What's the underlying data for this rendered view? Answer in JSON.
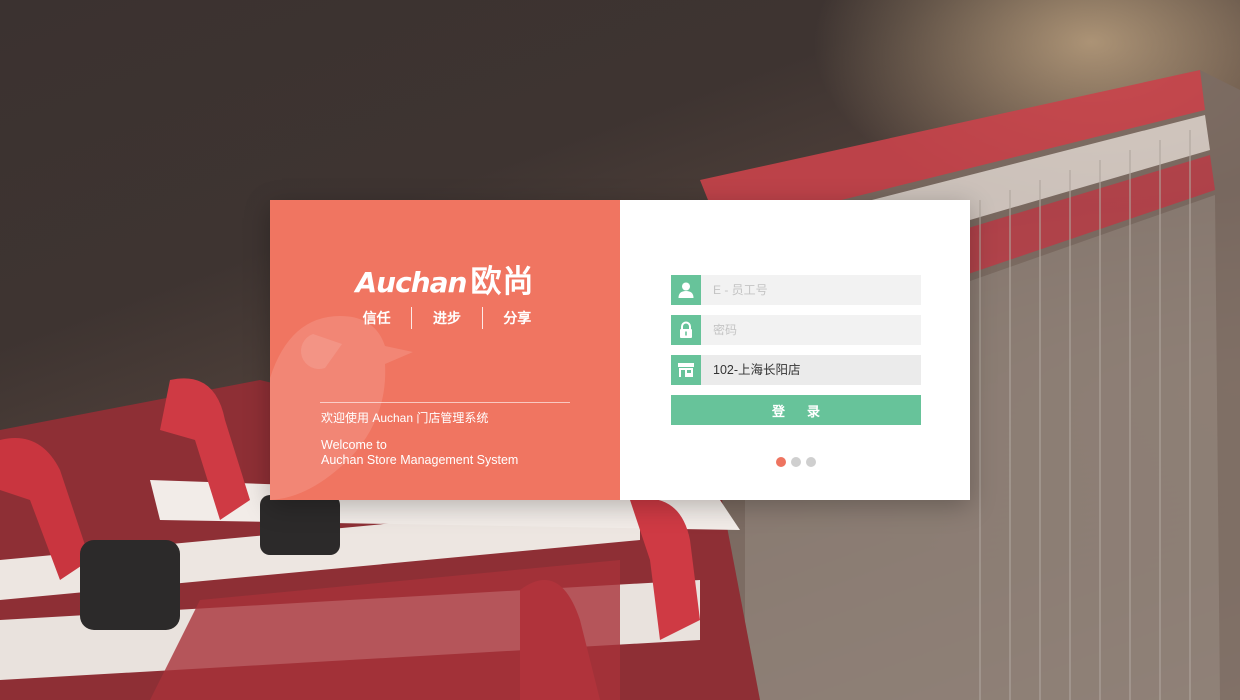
{
  "brand": {
    "name_en": "Auchan",
    "name_cn": "欧尚"
  },
  "motto": [
    "信任",
    "进步",
    "分享"
  ],
  "welcome": {
    "cn": "欢迎使用 Auchan 门店管理系统",
    "en_line1": "Welcome to",
    "en_line2": "Auchan Store Management System"
  },
  "form": {
    "employee_id": {
      "placeholder": "E - 员工号",
      "icon": "user-icon"
    },
    "password": {
      "placeholder": "密码",
      "icon": "lock-icon"
    },
    "store": {
      "value": "102-上海长阳店",
      "icon": "store-icon"
    },
    "login_label": "登录"
  },
  "carousel": {
    "count": 3,
    "active_index": 0
  },
  "colors": {
    "brand_coral": "#f07561",
    "accent_green": "#67c39a",
    "dot_active": "#ee7460",
    "dot_inactive": "#cfcfcf"
  },
  "background_image": "shopping carts"
}
